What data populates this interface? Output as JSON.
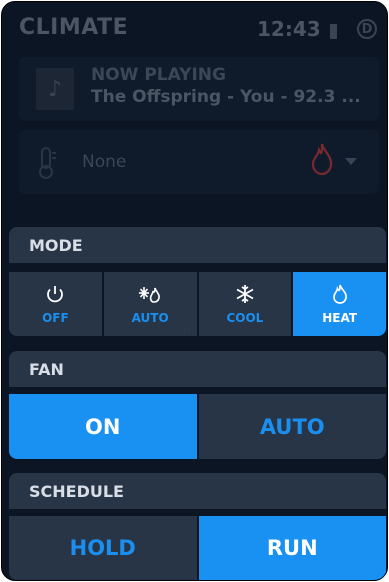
{
  "app": {
    "title": "CLIMATE",
    "time": "12:43",
    "badge": "D"
  },
  "now_playing": {
    "label": "NOW PLAYING",
    "track": "The Offspring - You - 92.3 ..."
  },
  "source": {
    "value": "None"
  },
  "mode": {
    "heading": "MODE",
    "options": [
      {
        "label": "OFF",
        "icon": "power-icon",
        "active": false
      },
      {
        "label": "AUTO",
        "icon": "snow-flame-icon",
        "active": false
      },
      {
        "label": "COOL",
        "icon": "snowflake-icon",
        "active": false
      },
      {
        "label": "HEAT",
        "icon": "flame-icon",
        "active": true
      }
    ]
  },
  "fan": {
    "heading": "FAN",
    "options": [
      {
        "label": "ON",
        "active": true
      },
      {
        "label": "AUTO",
        "active": false
      }
    ]
  },
  "schedule": {
    "heading": "SCHEDULE",
    "options": [
      {
        "label": "HOLD",
        "active": false
      },
      {
        "label": "RUN",
        "active": true
      }
    ]
  },
  "colors": {
    "accent": "#1891f2",
    "panel": "#283547",
    "background": "#0b1523",
    "heat_icon": "#7a2a2f"
  }
}
